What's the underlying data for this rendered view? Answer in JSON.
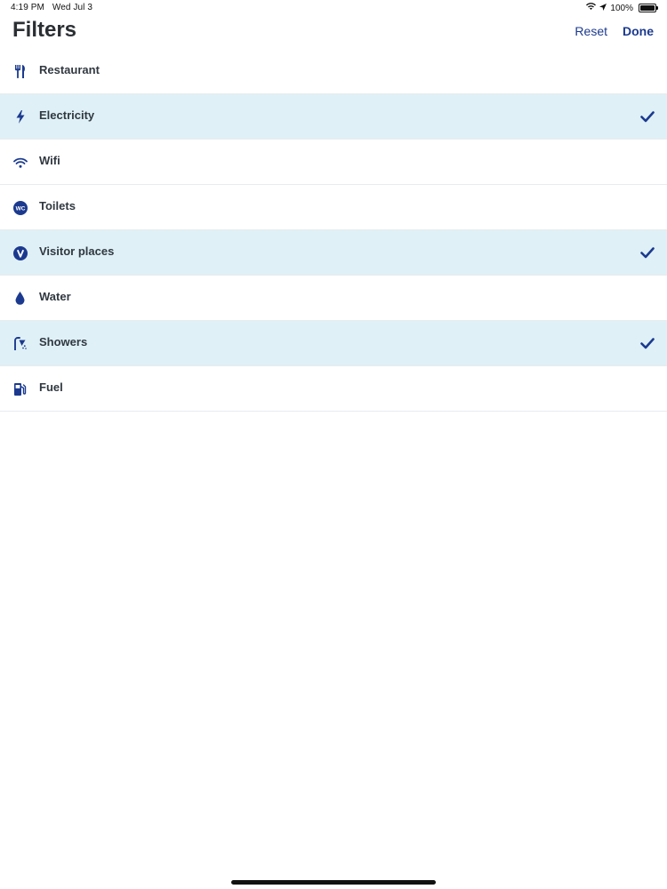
{
  "status_bar": {
    "time": "4:19 PM",
    "date": "Wed Jul 3",
    "battery": "100%",
    "icons": [
      "wifi-icon",
      "location-arrow-icon",
      "battery-icon"
    ]
  },
  "header": {
    "title": "Filters",
    "reset_label": "Reset",
    "done_label": "Done"
  },
  "filters": [
    {
      "label": "Restaurant",
      "icon": "fork-knife-icon",
      "selected": false
    },
    {
      "label": "Electricity",
      "icon": "lightning-icon",
      "selected": true
    },
    {
      "label": "Wifi",
      "icon": "wifi-icon",
      "selected": false
    },
    {
      "label": "Toilets",
      "icon": "wc-icon",
      "selected": false
    },
    {
      "label": "Visitor places",
      "icon": "visitor-v-icon",
      "selected": true
    },
    {
      "label": "Water",
      "icon": "water-drop-icon",
      "selected": false
    },
    {
      "label": "Showers",
      "icon": "shower-icon",
      "selected": true
    },
    {
      "label": "Fuel",
      "icon": "fuel-pump-icon",
      "selected": false
    }
  ],
  "colors": {
    "accent": "#1b3a8f",
    "selected_row": "#dff0f6",
    "divider": "#e8ecef"
  }
}
